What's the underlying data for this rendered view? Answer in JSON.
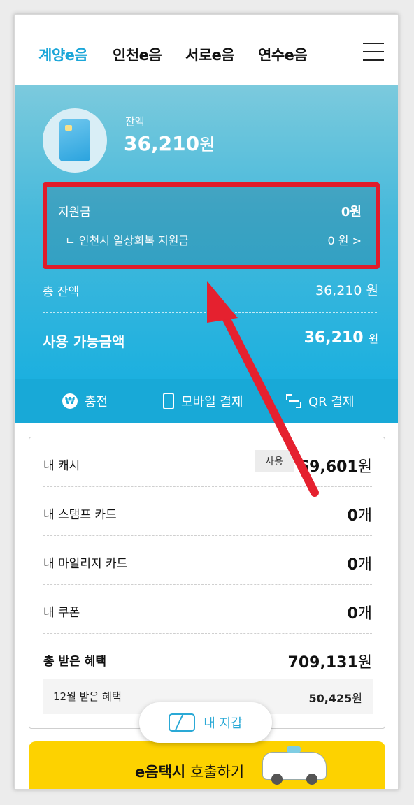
{
  "tabs": [
    "계양e음",
    "인천e음",
    "서로e음",
    "연수e음"
  ],
  "balance": {
    "label": "잔액",
    "amount": "36,210",
    "unit": "원"
  },
  "subsidy": {
    "title": "지원금",
    "amount": "0원",
    "item_label": "ㄴ 인천시 일상회복 지원금",
    "item_amount": "0 원 >"
  },
  "total": {
    "label": "총 잔액",
    "value": "36,210 원"
  },
  "available": {
    "label": "사용 가능금액",
    "amount": "36,210",
    "unit": "원"
  },
  "actions": {
    "charge": "충전",
    "mobile_pay": "모바일 결제",
    "qr_pay": "QR 결제",
    "won_symbol": "₩"
  },
  "benefits": {
    "cash": {
      "label": "내 캐시",
      "button": "사용",
      "value": "69,601",
      "unit": "원"
    },
    "stamp": {
      "label": "내 스탬프 카드",
      "value": "0",
      "unit": "개"
    },
    "mileage": {
      "label": "내 마일리지 카드",
      "value": "0",
      "unit": "개"
    },
    "coupon": {
      "label": "내 쿠폰",
      "value": "0",
      "unit": "개"
    },
    "total": {
      "label": "총 받은 혜택",
      "value": "709,131",
      "unit": "원"
    },
    "month": {
      "label": "12월 받은 혜택",
      "value": "50,425",
      "unit": "원"
    }
  },
  "wallet": {
    "label": "내 지갑"
  },
  "taxi": {
    "bold": "e음택시",
    "rest": " 호출하기"
  },
  "colors": {
    "accent": "#1aa6d8",
    "highlight": "#e01b2a",
    "taxi": "#fdd200"
  },
  "icons": [
    "hamburger-menu-icon",
    "won-icon",
    "phone-icon",
    "qr-icon",
    "wallet-icon",
    "arrow-icon"
  ]
}
